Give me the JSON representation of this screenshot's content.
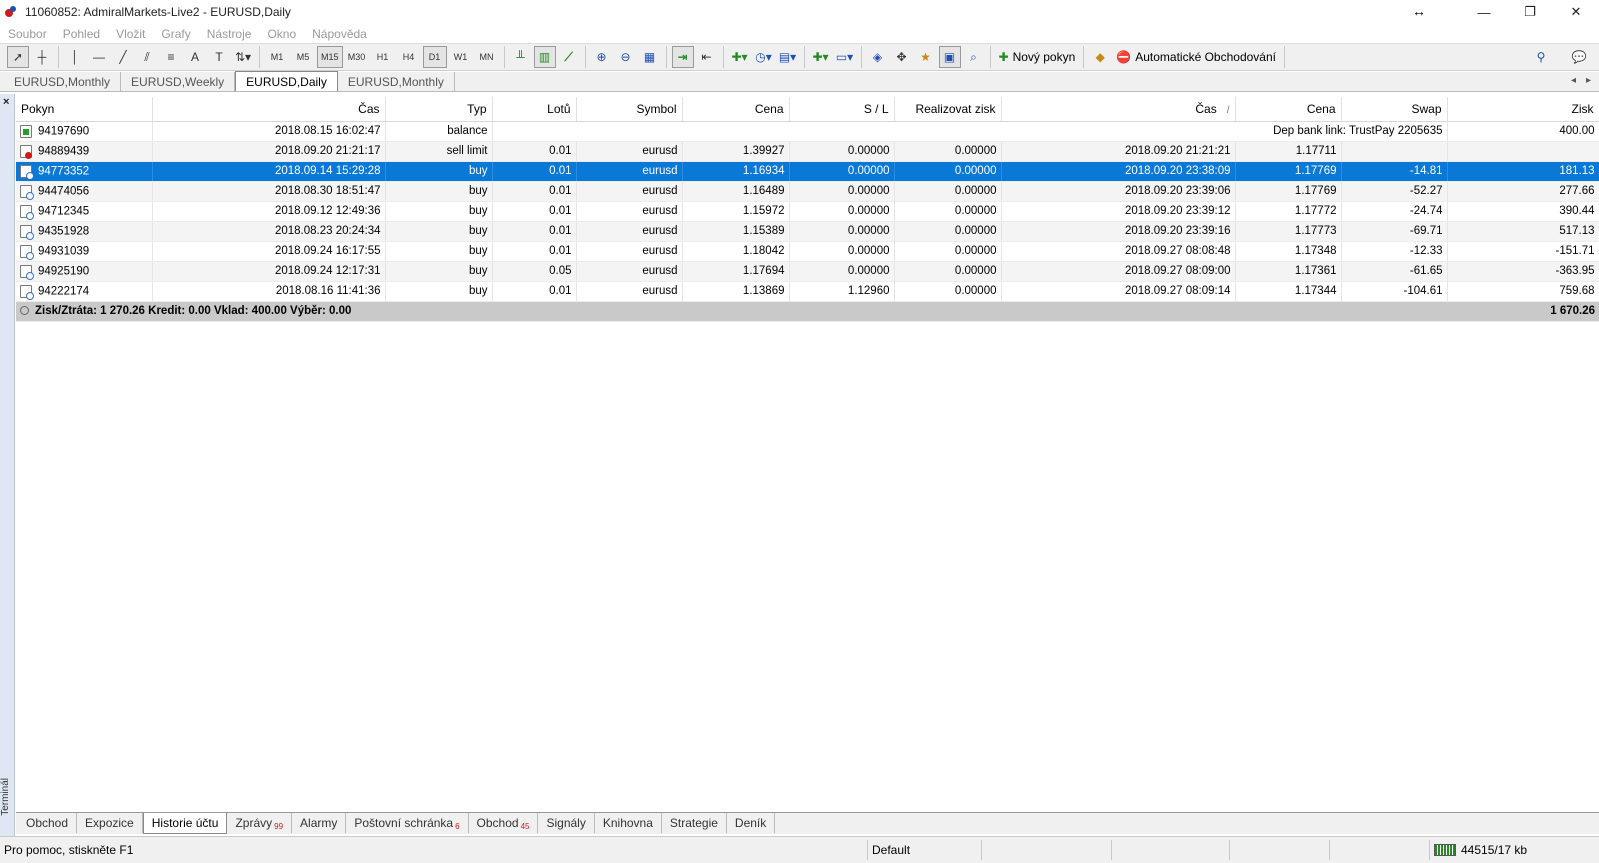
{
  "window": {
    "title": "11060852: AdmiralMarkets-Live2 - EURUSD,Daily"
  },
  "menu": [
    "Soubor",
    "Pohled",
    "Vložit",
    "Grafy",
    "Nástroje",
    "Okno",
    "Nápověda"
  ],
  "toolbar": {
    "timeframes": [
      "M1",
      "M5",
      "M15",
      "M30",
      "H1",
      "H4",
      "D1",
      "W1",
      "MN"
    ],
    "new_order_label": "Nový pokyn",
    "auto_trading_label": "Automatické Obchodování"
  },
  "chart_tabs": [
    "EURUSD,Monthly",
    "EURUSD,Weekly",
    "EURUSD,Daily",
    "EURUSD,Monthly"
  ],
  "terminal": {
    "close": "×",
    "label": "Terminál"
  },
  "table": {
    "headers": [
      "Pokyn",
      "Čas",
      "Typ",
      "Lotů",
      "Symbol",
      "Cena",
      "S / L",
      "Realizovat zisk",
      "Čas",
      "Cena",
      "Swap",
      "Zisk"
    ],
    "sort_mark": "/",
    "balance_row": {
      "order": "94197690",
      "time": "2018.08.15 16:02:47",
      "type": "balance",
      "comment": "Dep bank link: TrustPay 2205635",
      "profit": "400.00"
    },
    "rows": [
      {
        "order": "94889439",
        "time": "2018.09.20 21:21:17",
        "type": "sell limit",
        "lots": "0.01",
        "symbol": "eurusd",
        "price": "1.39927",
        "sl": "0.00000",
        "tp": "0.00000",
        "close_time": "2018.09.20 21:21:21",
        "close_price": "1.17711",
        "swap": "",
        "profit": ""
      },
      {
        "order": "94773352",
        "time": "2018.09.14 15:29:28",
        "type": "buy",
        "lots": "0.01",
        "symbol": "eurusd",
        "price": "1.16934",
        "sl": "0.00000",
        "tp": "0.00000",
        "close_time": "2018.09.20 23:38:09",
        "close_price": "1.17769",
        "swap": "-14.81",
        "profit": "181.13"
      },
      {
        "order": "94474056",
        "time": "2018.08.30 18:51:47",
        "type": "buy",
        "lots": "0.01",
        "symbol": "eurusd",
        "price": "1.16489",
        "sl": "0.00000",
        "tp": "0.00000",
        "close_time": "2018.09.20 23:39:06",
        "close_price": "1.17769",
        "swap": "-52.27",
        "profit": "277.66"
      },
      {
        "order": "94712345",
        "time": "2018.09.12 12:49:36",
        "type": "buy",
        "lots": "0.01",
        "symbol": "eurusd",
        "price": "1.15972",
        "sl": "0.00000",
        "tp": "0.00000",
        "close_time": "2018.09.20 23:39:12",
        "close_price": "1.17772",
        "swap": "-24.74",
        "profit": "390.44"
      },
      {
        "order": "94351928",
        "time": "2018.08.23 20:24:34",
        "type": "buy",
        "lots": "0.01",
        "symbol": "eurusd",
        "price": "1.15389",
        "sl": "0.00000",
        "tp": "0.00000",
        "close_time": "2018.09.20 23:39:16",
        "close_price": "1.17773",
        "swap": "-69.71",
        "profit": "517.13"
      },
      {
        "order": "94931039",
        "time": "2018.09.24 16:17:55",
        "type": "buy",
        "lots": "0.01",
        "symbol": "eurusd",
        "price": "1.18042",
        "sl": "0.00000",
        "tp": "0.00000",
        "close_time": "2018.09.27 08:08:48",
        "close_price": "1.17348",
        "swap": "-12.33",
        "profit": "-151.71"
      },
      {
        "order": "94925190",
        "time": "2018.09.24 12:17:31",
        "type": "buy",
        "lots": "0.05",
        "symbol": "eurusd",
        "price": "1.17694",
        "sl": "0.00000",
        "tp": "0.00000",
        "close_time": "2018.09.27 08:09:00",
        "close_price": "1.17361",
        "swap": "-61.65",
        "profit": "-363.95"
      },
      {
        "order": "94222174",
        "time": "2018.08.16 11:41:36",
        "type": "buy",
        "lots": "0.01",
        "symbol": "eurusd",
        "price": "1.13869",
        "sl": "1.12960",
        "tp": "0.00000",
        "close_time": "2018.09.27 08:09:14",
        "close_price": "1.17344",
        "swap": "-104.61",
        "profit": "759.68"
      }
    ],
    "total_label": "Zisk/Ztráta: 1 270.26  Kredit: 0.00  Vklad: 400.00  Výběr: 0.00",
    "total_profit": "1 670.26"
  },
  "bottom_tabs": [
    {
      "label": "Obchod",
      "badge": ""
    },
    {
      "label": "Expozice",
      "badge": ""
    },
    {
      "label": "Historie účtu",
      "badge": ""
    },
    {
      "label": "Zprávy",
      "badge": "99"
    },
    {
      "label": "Alarmy",
      "badge": ""
    },
    {
      "label": "Poštovní schránka",
      "badge": "6"
    },
    {
      "label": "Obchod",
      "badge": "45"
    },
    {
      "label": "Signály",
      "badge": ""
    },
    {
      "label": "Knihovna",
      "badge": ""
    },
    {
      "label": "Strategie",
      "badge": ""
    },
    {
      "label": "Deník",
      "badge": ""
    }
  ],
  "status": {
    "help": "Pro pomoc, stiskněte F1",
    "profile": "Default",
    "traffic": "44515/17 kb"
  }
}
